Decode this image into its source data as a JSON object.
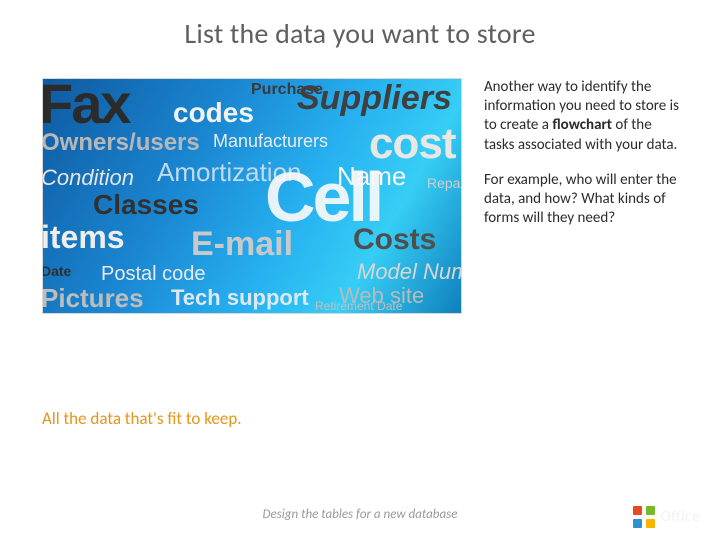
{
  "title": "List the data you want to store",
  "body": {
    "p1_a": "Another way to identify the information you need to store is to create a ",
    "p1_b": "flowchart",
    "p1_c": " of the tasks associated with your data.",
    "p2": "For example, who will enter the data, and how? What kinds of forms will they need?"
  },
  "subcaption": "All the data that's fit to keep.",
  "footer": "Design the tables for a new database",
  "brand": "Office",
  "wordcloud": {
    "fax": "Fax",
    "codes": "codes",
    "purchase": "Purchase",
    "suppliers": "Suppliers",
    "owners": "Owners/users",
    "manufacturers": "Manufacturers",
    "cost": "cost",
    "condition": "Condition",
    "amortization": "Amortization",
    "name": "Name",
    "repair": "Repair",
    "classes": "Classes",
    "cell": "Cell",
    "items": "items",
    "email": "E-mail",
    "costs2": "Costs",
    "date": "Date",
    "postal": "Postal code",
    "model": "Model Numb",
    "pictures": "Pictures",
    "tech": "Tech support",
    "web": "Web site",
    "retirement": "Retirement Date"
  }
}
